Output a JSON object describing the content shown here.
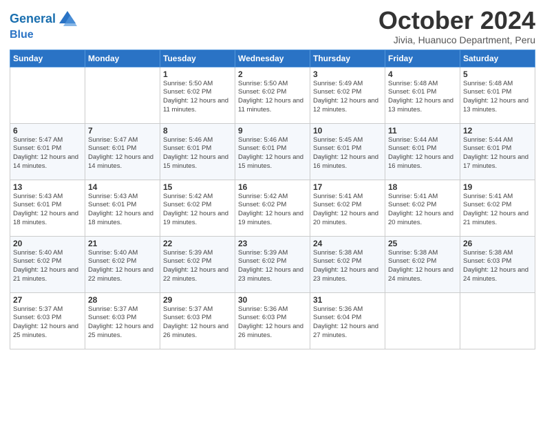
{
  "logo": {
    "line1": "General",
    "line2": "Blue"
  },
  "title": "October 2024",
  "location": "Jivia, Huanuco Department, Peru",
  "weekdays": [
    "Sunday",
    "Monday",
    "Tuesday",
    "Wednesday",
    "Thursday",
    "Friday",
    "Saturday"
  ],
  "weeks": [
    [
      {
        "day": "",
        "sunrise": "",
        "sunset": "",
        "daylight": ""
      },
      {
        "day": "",
        "sunrise": "",
        "sunset": "",
        "daylight": ""
      },
      {
        "day": "1",
        "sunrise": "Sunrise: 5:50 AM",
        "sunset": "Sunset: 6:02 PM",
        "daylight": "Daylight: 12 hours and 11 minutes."
      },
      {
        "day": "2",
        "sunrise": "Sunrise: 5:50 AM",
        "sunset": "Sunset: 6:02 PM",
        "daylight": "Daylight: 12 hours and 11 minutes."
      },
      {
        "day": "3",
        "sunrise": "Sunrise: 5:49 AM",
        "sunset": "Sunset: 6:02 PM",
        "daylight": "Daylight: 12 hours and 12 minutes."
      },
      {
        "day": "4",
        "sunrise": "Sunrise: 5:48 AM",
        "sunset": "Sunset: 6:01 PM",
        "daylight": "Daylight: 12 hours and 13 minutes."
      },
      {
        "day": "5",
        "sunrise": "Sunrise: 5:48 AM",
        "sunset": "Sunset: 6:01 PM",
        "daylight": "Daylight: 12 hours and 13 minutes."
      }
    ],
    [
      {
        "day": "6",
        "sunrise": "Sunrise: 5:47 AM",
        "sunset": "Sunset: 6:01 PM",
        "daylight": "Daylight: 12 hours and 14 minutes."
      },
      {
        "day": "7",
        "sunrise": "Sunrise: 5:47 AM",
        "sunset": "Sunset: 6:01 PM",
        "daylight": "Daylight: 12 hours and 14 minutes."
      },
      {
        "day": "8",
        "sunrise": "Sunrise: 5:46 AM",
        "sunset": "Sunset: 6:01 PM",
        "daylight": "Daylight: 12 hours and 15 minutes."
      },
      {
        "day": "9",
        "sunrise": "Sunrise: 5:46 AM",
        "sunset": "Sunset: 6:01 PM",
        "daylight": "Daylight: 12 hours and 15 minutes."
      },
      {
        "day": "10",
        "sunrise": "Sunrise: 5:45 AM",
        "sunset": "Sunset: 6:01 PM",
        "daylight": "Daylight: 12 hours and 16 minutes."
      },
      {
        "day": "11",
        "sunrise": "Sunrise: 5:44 AM",
        "sunset": "Sunset: 6:01 PM",
        "daylight": "Daylight: 12 hours and 16 minutes."
      },
      {
        "day": "12",
        "sunrise": "Sunrise: 5:44 AM",
        "sunset": "Sunset: 6:01 PM",
        "daylight": "Daylight: 12 hours and 17 minutes."
      }
    ],
    [
      {
        "day": "13",
        "sunrise": "Sunrise: 5:43 AM",
        "sunset": "Sunset: 6:01 PM",
        "daylight": "Daylight: 12 hours and 18 minutes."
      },
      {
        "day": "14",
        "sunrise": "Sunrise: 5:43 AM",
        "sunset": "Sunset: 6:01 PM",
        "daylight": "Daylight: 12 hours and 18 minutes."
      },
      {
        "day": "15",
        "sunrise": "Sunrise: 5:42 AM",
        "sunset": "Sunset: 6:02 PM",
        "daylight": "Daylight: 12 hours and 19 minutes."
      },
      {
        "day": "16",
        "sunrise": "Sunrise: 5:42 AM",
        "sunset": "Sunset: 6:02 PM",
        "daylight": "Daylight: 12 hours and 19 minutes."
      },
      {
        "day": "17",
        "sunrise": "Sunrise: 5:41 AM",
        "sunset": "Sunset: 6:02 PM",
        "daylight": "Daylight: 12 hours and 20 minutes."
      },
      {
        "day": "18",
        "sunrise": "Sunrise: 5:41 AM",
        "sunset": "Sunset: 6:02 PM",
        "daylight": "Daylight: 12 hours and 20 minutes."
      },
      {
        "day": "19",
        "sunrise": "Sunrise: 5:41 AM",
        "sunset": "Sunset: 6:02 PM",
        "daylight": "Daylight: 12 hours and 21 minutes."
      }
    ],
    [
      {
        "day": "20",
        "sunrise": "Sunrise: 5:40 AM",
        "sunset": "Sunset: 6:02 PM",
        "daylight": "Daylight: 12 hours and 21 minutes."
      },
      {
        "day": "21",
        "sunrise": "Sunrise: 5:40 AM",
        "sunset": "Sunset: 6:02 PM",
        "daylight": "Daylight: 12 hours and 22 minutes."
      },
      {
        "day": "22",
        "sunrise": "Sunrise: 5:39 AM",
        "sunset": "Sunset: 6:02 PM",
        "daylight": "Daylight: 12 hours and 22 minutes."
      },
      {
        "day": "23",
        "sunrise": "Sunrise: 5:39 AM",
        "sunset": "Sunset: 6:02 PM",
        "daylight": "Daylight: 12 hours and 23 minutes."
      },
      {
        "day": "24",
        "sunrise": "Sunrise: 5:38 AM",
        "sunset": "Sunset: 6:02 PM",
        "daylight": "Daylight: 12 hours and 23 minutes."
      },
      {
        "day": "25",
        "sunrise": "Sunrise: 5:38 AM",
        "sunset": "Sunset: 6:02 PM",
        "daylight": "Daylight: 12 hours and 24 minutes."
      },
      {
        "day": "26",
        "sunrise": "Sunrise: 5:38 AM",
        "sunset": "Sunset: 6:03 PM",
        "daylight": "Daylight: 12 hours and 24 minutes."
      }
    ],
    [
      {
        "day": "27",
        "sunrise": "Sunrise: 5:37 AM",
        "sunset": "Sunset: 6:03 PM",
        "daylight": "Daylight: 12 hours and 25 minutes."
      },
      {
        "day": "28",
        "sunrise": "Sunrise: 5:37 AM",
        "sunset": "Sunset: 6:03 PM",
        "daylight": "Daylight: 12 hours and 25 minutes."
      },
      {
        "day": "29",
        "sunrise": "Sunrise: 5:37 AM",
        "sunset": "Sunset: 6:03 PM",
        "daylight": "Daylight: 12 hours and 26 minutes."
      },
      {
        "day": "30",
        "sunrise": "Sunrise: 5:36 AM",
        "sunset": "Sunset: 6:03 PM",
        "daylight": "Daylight: 12 hours and 26 minutes."
      },
      {
        "day": "31",
        "sunrise": "Sunrise: 5:36 AM",
        "sunset": "Sunset: 6:04 PM",
        "daylight": "Daylight: 12 hours and 27 minutes."
      },
      {
        "day": "",
        "sunrise": "",
        "sunset": "",
        "daylight": ""
      },
      {
        "day": "",
        "sunrise": "",
        "sunset": "",
        "daylight": ""
      }
    ]
  ]
}
